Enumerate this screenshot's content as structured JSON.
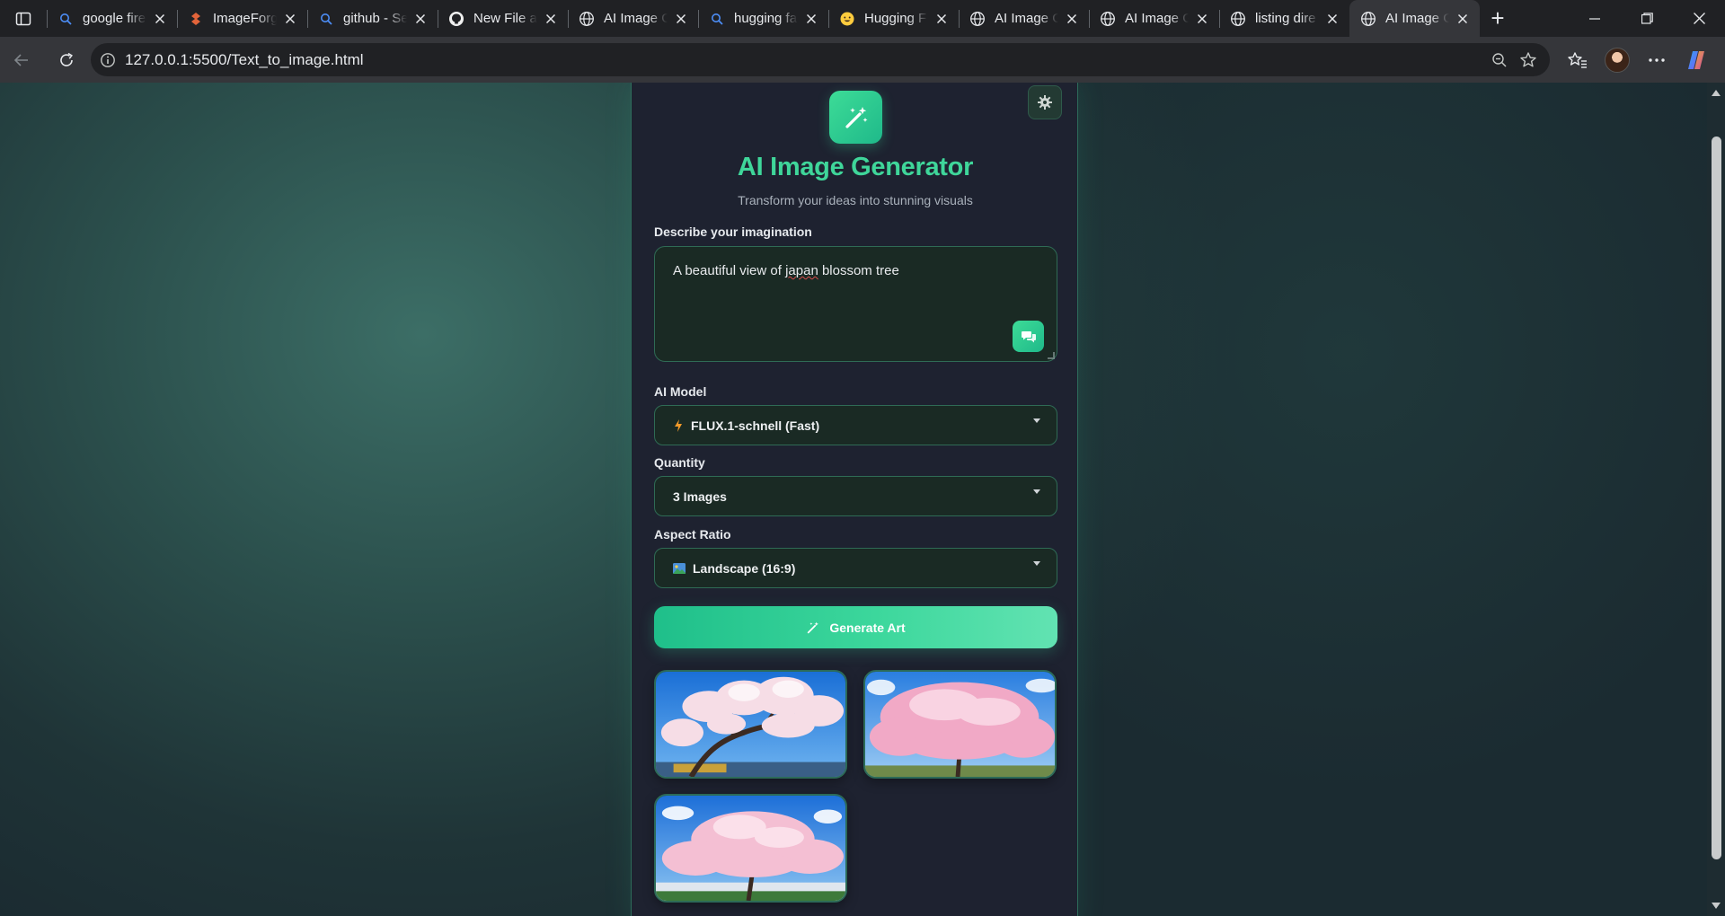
{
  "browser": {
    "tabs": [
      {
        "title": "google fire",
        "icon": "search-icon"
      },
      {
        "title": "ImageForge",
        "icon": "imageforge-icon"
      },
      {
        "title": "github - Se",
        "icon": "search-icon"
      },
      {
        "title": "New File a",
        "icon": "github-icon"
      },
      {
        "title": "AI Image G",
        "icon": "globe-icon"
      },
      {
        "title": "hugging fa",
        "icon": "search-icon"
      },
      {
        "title": "Hugging F",
        "icon": "hugging-face-icon"
      },
      {
        "title": "AI Image G",
        "icon": "globe-icon"
      },
      {
        "title": "AI Image G",
        "icon": "globe-icon"
      },
      {
        "title": "listing dire",
        "icon": "globe-icon"
      },
      {
        "title": "AI Image G",
        "icon": "globe-icon",
        "active": true
      }
    ],
    "url": "127.0.0.1:5500/Text_to_image.html"
  },
  "app": {
    "title": "AI Image Generator",
    "subtitle": "Transform your ideas into stunning visuals",
    "prompt_label": "Describe your imagination",
    "prompt_before": "A beautiful view of ",
    "prompt_misspelled": "japan",
    "prompt_after": " blossom tree",
    "model_label": "AI Model",
    "model_value": "FLUX.1-schnell (Fast)",
    "quantity_label": "Quantity",
    "quantity_value": "3 Images",
    "ratio_label": "Aspect Ratio",
    "ratio_value": "Landscape (16:9)",
    "generate_label": "Generate Art",
    "generated_images": [
      {
        "subject": "cherry blossom tree"
      },
      {
        "subject": "cherry blossom tree"
      },
      {
        "subject": "cherry blossom tree"
      }
    ]
  },
  "colors": {
    "accent": "#3fd69a",
    "card_bg": "#1e2230",
    "field_bg": "#1a2a24",
    "page_bg": "#2b4f4c"
  }
}
